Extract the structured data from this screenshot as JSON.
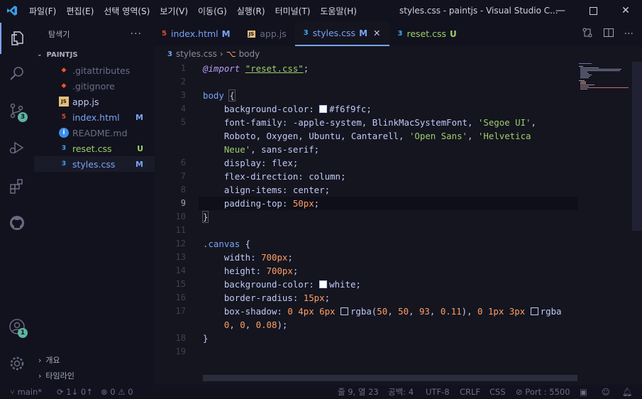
{
  "menu": [
    "파일(F)",
    "편집(E)",
    "선택 영역(S)",
    "보기(V)",
    "이동(G)",
    "실행(R)",
    "터미널(T)",
    "도움말(H)"
  ],
  "window_title": "styles.css - paintjs - Visual Studio C...",
  "sidebar": {
    "title": "탐색기",
    "root": "PAINTJS",
    "files": [
      {
        "name": ".gitattributes",
        "icon": "git-icon",
        "status": "",
        "color": "#6b6e85"
      },
      {
        "name": ".gitignore",
        "icon": "git-icon",
        "status": "",
        "color": "#6b6e85"
      },
      {
        "name": "app.js",
        "icon": "js-icon",
        "status": "",
        "color": "#c0caf5"
      },
      {
        "name": "index.html",
        "icon": "html-icon",
        "status": "M",
        "color": "#7aa2f7"
      },
      {
        "name": "README.md",
        "icon": "info-icon",
        "status": "",
        "color": "#6b6e85"
      },
      {
        "name": "reset.css",
        "icon": "css-icon",
        "status": "U",
        "color": "#9ece6a"
      },
      {
        "name": "styles.css",
        "icon": "css-icon",
        "status": "M",
        "color": "#7aa2f7"
      }
    ],
    "outline": "개요",
    "timeline": "타임라인"
  },
  "tabs": [
    {
      "label": "index.html",
      "status": "M",
      "icon": "html-icon"
    },
    {
      "label": "app.js",
      "status": "",
      "icon": "js-icon"
    },
    {
      "label": "styles.css",
      "status": "M",
      "icon": "css-icon",
      "active": true
    },
    {
      "label": "reset.css",
      "status": "U",
      "icon": "css-icon"
    }
  ],
  "breadcrumb": {
    "file": "styles.css",
    "symbol": "body"
  },
  "line_numbers": [
    "1",
    "2",
    "3",
    "4",
    "5",
    "",
    "",
    "6",
    "7",
    "8",
    "9",
    "10",
    "11",
    "12",
    "13",
    "14",
    "15",
    "16",
    "17",
    "",
    "18",
    "19"
  ],
  "current_line": "9",
  "activity_badges": {
    "source_control": "3",
    "accounts": "1"
  },
  "colors": {
    "accent": "#7aa2f7",
    "background": "#14151f",
    "sidebar": "#11121d",
    "badge": "#5fb3a1"
  },
  "status": {
    "branch": "main*",
    "sync": "1↓ 0↑",
    "problems": "0 ⚠ 0",
    "cursor": "줄 9, 열 23",
    "spaces": "공백: 4",
    "encoding": "UTF-8",
    "eol": "CRLF",
    "language": "CSS",
    "port": "Port : 5500"
  }
}
